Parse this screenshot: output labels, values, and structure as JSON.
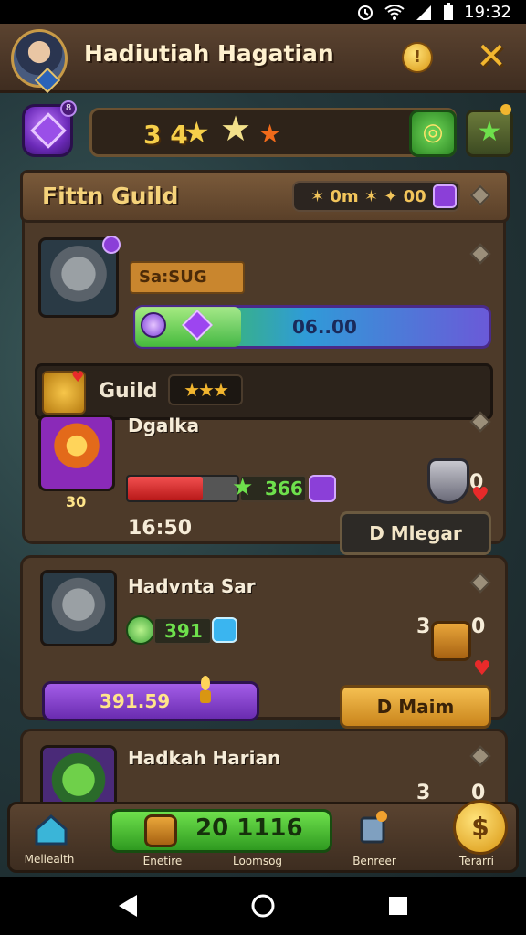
{
  "status_bar": {
    "time": "19:32",
    "icons": [
      "alarm-icon",
      "wifi-icon",
      "signal-icon",
      "battery-icon"
    ]
  },
  "header": {
    "title": "Hadiutiah Hagatian",
    "coin_symbol": "!",
    "close_symbol": "✕"
  },
  "currency": {
    "gem_badge": "8",
    "stars_count": "3 4",
    "stars_icons": [
      "star",
      "star",
      "star"
    ],
    "chat_symbol": "◎",
    "plus_symbol": "★"
  },
  "guild": {
    "title": "Fittn Guild",
    "resource_text": "✶ 0m ✶ ✦ 00",
    "leader": {
      "name_plate": "Sa:SUG",
      "xp_text": "06..00",
      "xp_fraction": 0.3
    },
    "row": {
      "label": "Guild",
      "stars": "★★★"
    },
    "member": {
      "name": "Dgalka",
      "level_text": "30",
      "hp_fraction": 0.68,
      "value": "366",
      "time": "16:50",
      "side_count": "0",
      "button": "D Mlegar"
    }
  },
  "cards": [
    {
      "name": "Hadvnta Sar",
      "value": "391",
      "pill_text": "391.59",
      "side_count_left": "3",
      "side_count_right": "0",
      "button": "D Maim"
    },
    {
      "name": "Hadkah Harian",
      "side_count_left": "3",
      "side_count_right": "0"
    }
  ],
  "bottom_nav": {
    "items": [
      {
        "label": "Mellealth",
        "icon": "house-icon"
      },
      {
        "label": "Enetire",
        "icon": "chest-icon"
      },
      {
        "label": "Loomsog",
        "icon": "scroll-icon"
      },
      {
        "label": "Benreer",
        "icon": "trash-icon"
      },
      {
        "label": "Terarri",
        "icon": "coin-icon"
      }
    ],
    "main_value": "20 1116",
    "gold_symbol": "$"
  },
  "colors": {
    "gold": "#f2b62f",
    "panel": "#4d3a29",
    "green": "#3ec24a",
    "purple": "#8b3fd8",
    "red": "#e82a2a"
  }
}
